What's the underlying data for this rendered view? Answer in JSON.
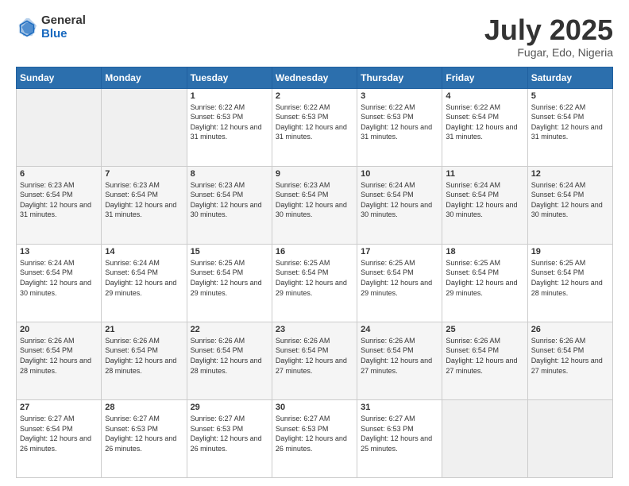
{
  "header": {
    "logo_general": "General",
    "logo_blue": "Blue",
    "month_title": "July 2025",
    "location": "Fugar, Edo, Nigeria"
  },
  "days_of_week": [
    "Sunday",
    "Monday",
    "Tuesday",
    "Wednesday",
    "Thursday",
    "Friday",
    "Saturday"
  ],
  "weeks": [
    [
      {
        "day": "",
        "info": ""
      },
      {
        "day": "",
        "info": ""
      },
      {
        "day": "1",
        "info": "Sunrise: 6:22 AM\nSunset: 6:53 PM\nDaylight: 12 hours and 31 minutes."
      },
      {
        "day": "2",
        "info": "Sunrise: 6:22 AM\nSunset: 6:53 PM\nDaylight: 12 hours and 31 minutes."
      },
      {
        "day": "3",
        "info": "Sunrise: 6:22 AM\nSunset: 6:53 PM\nDaylight: 12 hours and 31 minutes."
      },
      {
        "day": "4",
        "info": "Sunrise: 6:22 AM\nSunset: 6:54 PM\nDaylight: 12 hours and 31 minutes."
      },
      {
        "day": "5",
        "info": "Sunrise: 6:22 AM\nSunset: 6:54 PM\nDaylight: 12 hours and 31 minutes."
      }
    ],
    [
      {
        "day": "6",
        "info": "Sunrise: 6:23 AM\nSunset: 6:54 PM\nDaylight: 12 hours and 31 minutes."
      },
      {
        "day": "7",
        "info": "Sunrise: 6:23 AM\nSunset: 6:54 PM\nDaylight: 12 hours and 31 minutes."
      },
      {
        "day": "8",
        "info": "Sunrise: 6:23 AM\nSunset: 6:54 PM\nDaylight: 12 hours and 30 minutes."
      },
      {
        "day": "9",
        "info": "Sunrise: 6:23 AM\nSunset: 6:54 PM\nDaylight: 12 hours and 30 minutes."
      },
      {
        "day": "10",
        "info": "Sunrise: 6:24 AM\nSunset: 6:54 PM\nDaylight: 12 hours and 30 minutes."
      },
      {
        "day": "11",
        "info": "Sunrise: 6:24 AM\nSunset: 6:54 PM\nDaylight: 12 hours and 30 minutes."
      },
      {
        "day": "12",
        "info": "Sunrise: 6:24 AM\nSunset: 6:54 PM\nDaylight: 12 hours and 30 minutes."
      }
    ],
    [
      {
        "day": "13",
        "info": "Sunrise: 6:24 AM\nSunset: 6:54 PM\nDaylight: 12 hours and 30 minutes."
      },
      {
        "day": "14",
        "info": "Sunrise: 6:24 AM\nSunset: 6:54 PM\nDaylight: 12 hours and 29 minutes."
      },
      {
        "day": "15",
        "info": "Sunrise: 6:25 AM\nSunset: 6:54 PM\nDaylight: 12 hours and 29 minutes."
      },
      {
        "day": "16",
        "info": "Sunrise: 6:25 AM\nSunset: 6:54 PM\nDaylight: 12 hours and 29 minutes."
      },
      {
        "day": "17",
        "info": "Sunrise: 6:25 AM\nSunset: 6:54 PM\nDaylight: 12 hours and 29 minutes."
      },
      {
        "day": "18",
        "info": "Sunrise: 6:25 AM\nSunset: 6:54 PM\nDaylight: 12 hours and 29 minutes."
      },
      {
        "day": "19",
        "info": "Sunrise: 6:25 AM\nSunset: 6:54 PM\nDaylight: 12 hours and 28 minutes."
      }
    ],
    [
      {
        "day": "20",
        "info": "Sunrise: 6:26 AM\nSunset: 6:54 PM\nDaylight: 12 hours and 28 minutes."
      },
      {
        "day": "21",
        "info": "Sunrise: 6:26 AM\nSunset: 6:54 PM\nDaylight: 12 hours and 28 minutes."
      },
      {
        "day": "22",
        "info": "Sunrise: 6:26 AM\nSunset: 6:54 PM\nDaylight: 12 hours and 28 minutes."
      },
      {
        "day": "23",
        "info": "Sunrise: 6:26 AM\nSunset: 6:54 PM\nDaylight: 12 hours and 27 minutes."
      },
      {
        "day": "24",
        "info": "Sunrise: 6:26 AM\nSunset: 6:54 PM\nDaylight: 12 hours and 27 minutes."
      },
      {
        "day": "25",
        "info": "Sunrise: 6:26 AM\nSunset: 6:54 PM\nDaylight: 12 hours and 27 minutes."
      },
      {
        "day": "26",
        "info": "Sunrise: 6:26 AM\nSunset: 6:54 PM\nDaylight: 12 hours and 27 minutes."
      }
    ],
    [
      {
        "day": "27",
        "info": "Sunrise: 6:27 AM\nSunset: 6:54 PM\nDaylight: 12 hours and 26 minutes."
      },
      {
        "day": "28",
        "info": "Sunrise: 6:27 AM\nSunset: 6:53 PM\nDaylight: 12 hours and 26 minutes."
      },
      {
        "day": "29",
        "info": "Sunrise: 6:27 AM\nSunset: 6:53 PM\nDaylight: 12 hours and 26 minutes."
      },
      {
        "day": "30",
        "info": "Sunrise: 6:27 AM\nSunset: 6:53 PM\nDaylight: 12 hours and 26 minutes."
      },
      {
        "day": "31",
        "info": "Sunrise: 6:27 AM\nSunset: 6:53 PM\nDaylight: 12 hours and 25 minutes."
      },
      {
        "day": "",
        "info": ""
      },
      {
        "day": "",
        "info": ""
      }
    ]
  ]
}
